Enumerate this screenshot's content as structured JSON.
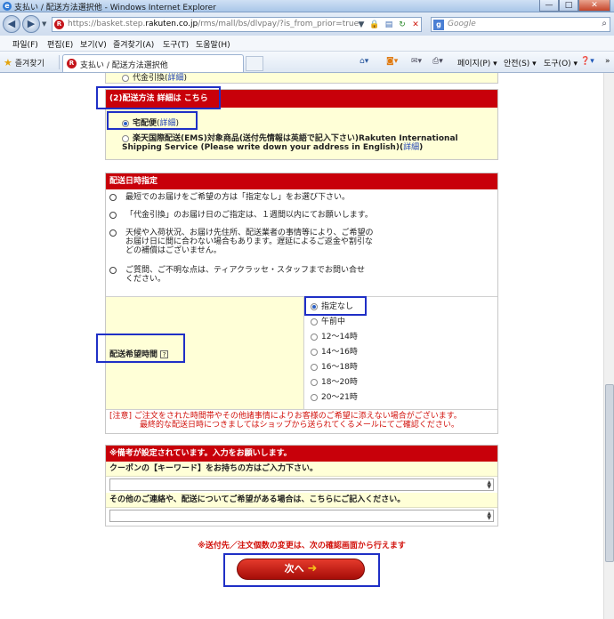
{
  "window": {
    "title": "支払い / 配送方法選択他 - Windows Internet Explorer",
    "minimize": "—",
    "maximize": "□",
    "close": "✕"
  },
  "address": {
    "url_prefix": "https://basket.step.",
    "url_domain": "rakuten.co.jp",
    "url_rest": "/rms/mall/bs/dlvpay/?is_from_prior=true",
    "search_placeholder": "Google"
  },
  "menu": {
    "items": [
      "파일(F)",
      "편집(E)",
      "보기(V)",
      "즐겨찾기(A)",
      "도구(T)",
      "도움말(H)"
    ]
  },
  "favorites": {
    "label": "즐겨찾기",
    "tab_title": "支払い / 配送方法選択他"
  },
  "commandbar": {
    "page": "페이지(P) ▾",
    "safety": "안전(S) ▾",
    "tools": "도구(O) ▾",
    "more": "»"
  },
  "payment": {
    "cod_label": "代金引換",
    "detail_link": "詳細"
  },
  "delivery_method": {
    "header": "(2)配送方法 詳細は こちら",
    "option_takkyubin": "宅配便",
    "detail_link": "詳細",
    "option_ems": "楽天国際配送(EMS)対象商品(送付先情報は英語で記入下さい)Rakuten International Shipping Service (Please write down your address in English)"
  },
  "delivery_date": {
    "header": "配送日時指定",
    "notes": [
      "最短でのお届けをご希望の方は「指定なし」をお選び下さい。",
      "「代金引換」のお届け日のご指定は、１週間以内にてお願いします。",
      "天候や入荷状況、お届け先住所、配送業者の事情等により、ご希望のお届け日に間に合わない場合もあります。遅延によるご返金や割引などの補償はございません。",
      "ご質問、ご不明な点は、ティアクラッセ・スタッフまでお問い合せください。"
    ],
    "time_label": "配送希望時間",
    "time_options": [
      "指定なし",
      "午前中",
      "12〜14時",
      "14〜16時",
      "16〜18時",
      "18〜20時",
      "20〜21時"
    ],
    "warning_line1": "[注意] ご注文をされた時間帯やその他諸事情によりお客様のご希望に添えない場合がございます。",
    "warning_line2": "最終的な配送日時につきましてはショップから送られてくるメールにてご確認ください。"
  },
  "remarks": {
    "header": "※備考が設定されています。入力をお願いします。",
    "coupon_label": "クーポンの【キーワード】をお持ちの方はご入力下さい。",
    "other_label": "その他のご連絡や、配送についてご希望がある場合は、こちらにご記入ください。"
  },
  "footer": {
    "notice": "※送付先／注文個数の変更は、次の確認画面から行えます",
    "next_button": "次へ"
  }
}
